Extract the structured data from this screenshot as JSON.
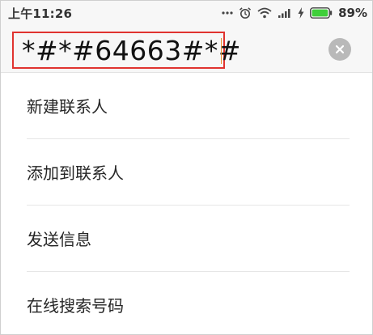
{
  "status_bar": {
    "time": "上午11:26",
    "battery_percent": "89%",
    "icons": [
      "alarm-icon",
      "wifi-icon",
      "signal-icon",
      "charging-icon",
      "battery-icon"
    ],
    "battery_color": "#3fcf3a"
  },
  "search": {
    "dialed_number": "*#*#64663#*#",
    "clear_icon": "close-icon",
    "highlight_color": "#e0332f"
  },
  "menu": {
    "items": [
      {
        "label": "新建联系人"
      },
      {
        "label": "添加到联系人"
      },
      {
        "label": "发送信息"
      },
      {
        "label": "在线搜索号码"
      }
    ]
  }
}
